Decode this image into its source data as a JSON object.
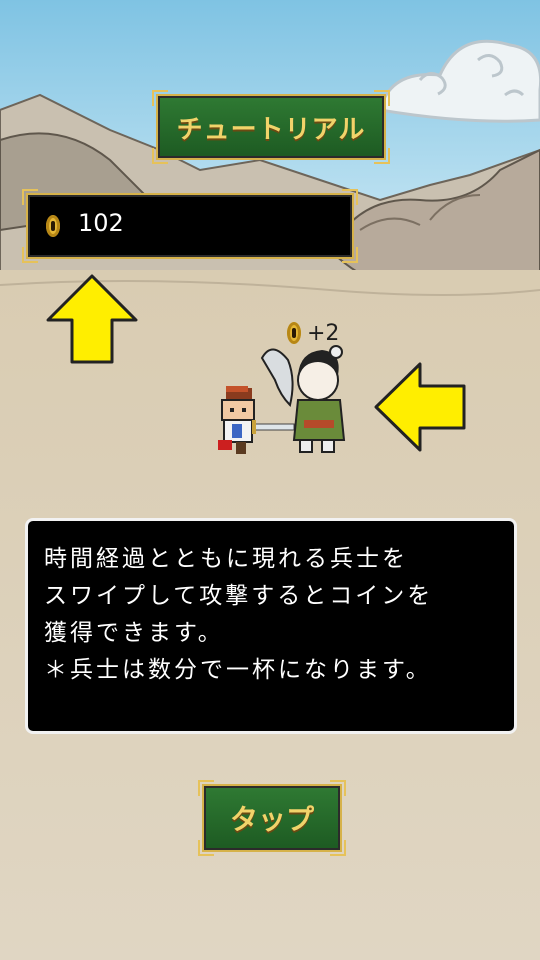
{
  "header": {
    "title": "チュートリアル"
  },
  "coins": {
    "count": "102"
  },
  "reward": {
    "text": "+2"
  },
  "message": {
    "lines": [
      "時間経過とともに現れる兵士を",
      "スワイプして攻撃するとコインを",
      "獲得できます。",
      "＊兵士は数分で一杯になります。"
    ]
  },
  "button": {
    "label": "タップ"
  },
  "colors": {
    "banner_green": "#1d5a22",
    "gold": "#e6c25a",
    "arrow_yellow": "#ffee00",
    "sky": "#9fd4ec"
  },
  "icons": [
    "coin-icon",
    "arrow-up-icon",
    "arrow-left-icon"
  ]
}
